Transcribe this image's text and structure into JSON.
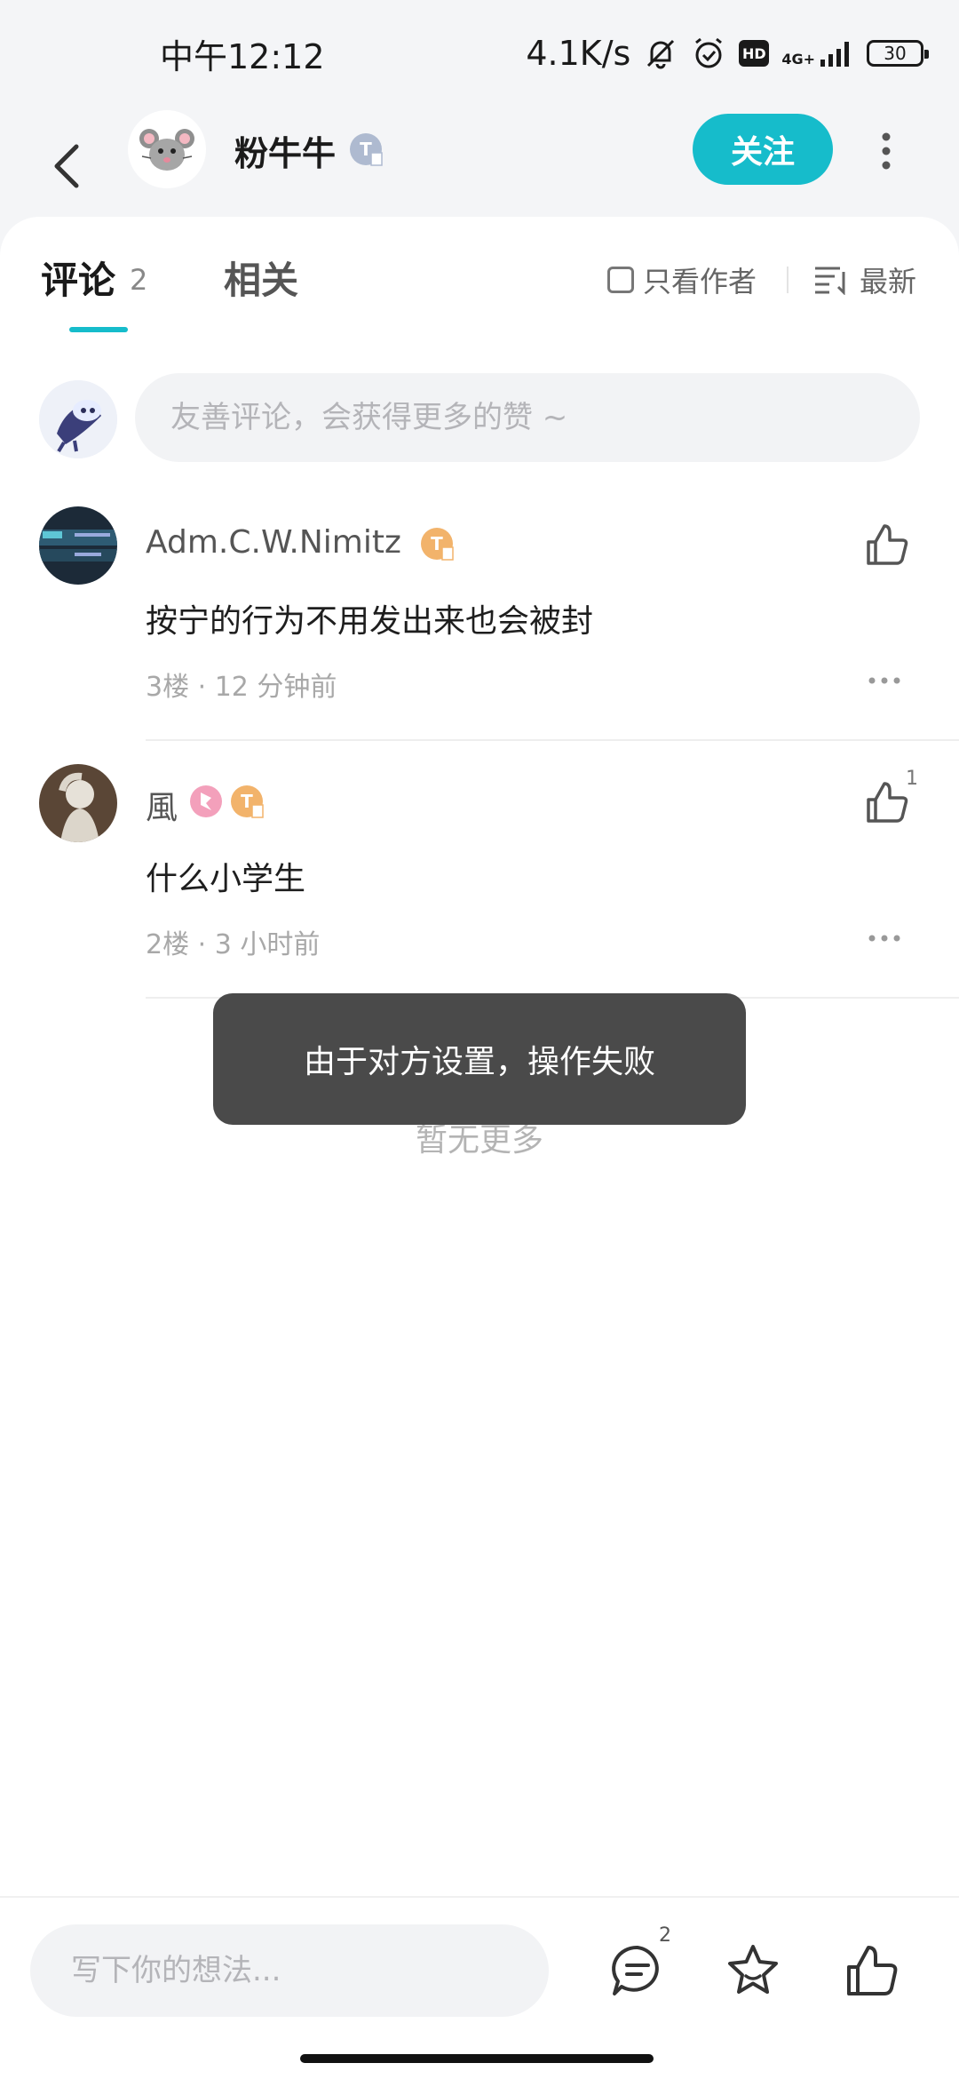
{
  "status_bar": {
    "time": "中午12:12",
    "net_speed": "4.1K/s",
    "hd": "HD",
    "network": "4G+",
    "battery": "30"
  },
  "header": {
    "author_name": "粉牛牛",
    "follow_label": "关注"
  },
  "tabs": {
    "comments_label": "评论",
    "comments_count": "2",
    "related_label": "相关",
    "author_only_label": "只看作者",
    "sort_label": "最新"
  },
  "comment_box": {
    "placeholder": "友善评论，会获得更多的赞 ~"
  },
  "comments": [
    {
      "name": "Adm.C.W.Nimitz",
      "text": "按宁的行为不用发出来也会被封",
      "meta": "3楼 · 12 分钟前",
      "likes": ""
    },
    {
      "name": "風",
      "text": "什么小学生",
      "meta": "2楼 · 3 小时前",
      "likes": "1"
    }
  ],
  "no_more": "暂无更多",
  "toast": "由于对方设置，操作失败",
  "bottom_bar": {
    "placeholder": "写下你的想法...",
    "comment_count": "2"
  },
  "colors": {
    "accent": "#16bccb",
    "toast_bg": "#4a4a4a",
    "badge_gold": "#f2b36b",
    "badge_gray": "#aebad0"
  }
}
